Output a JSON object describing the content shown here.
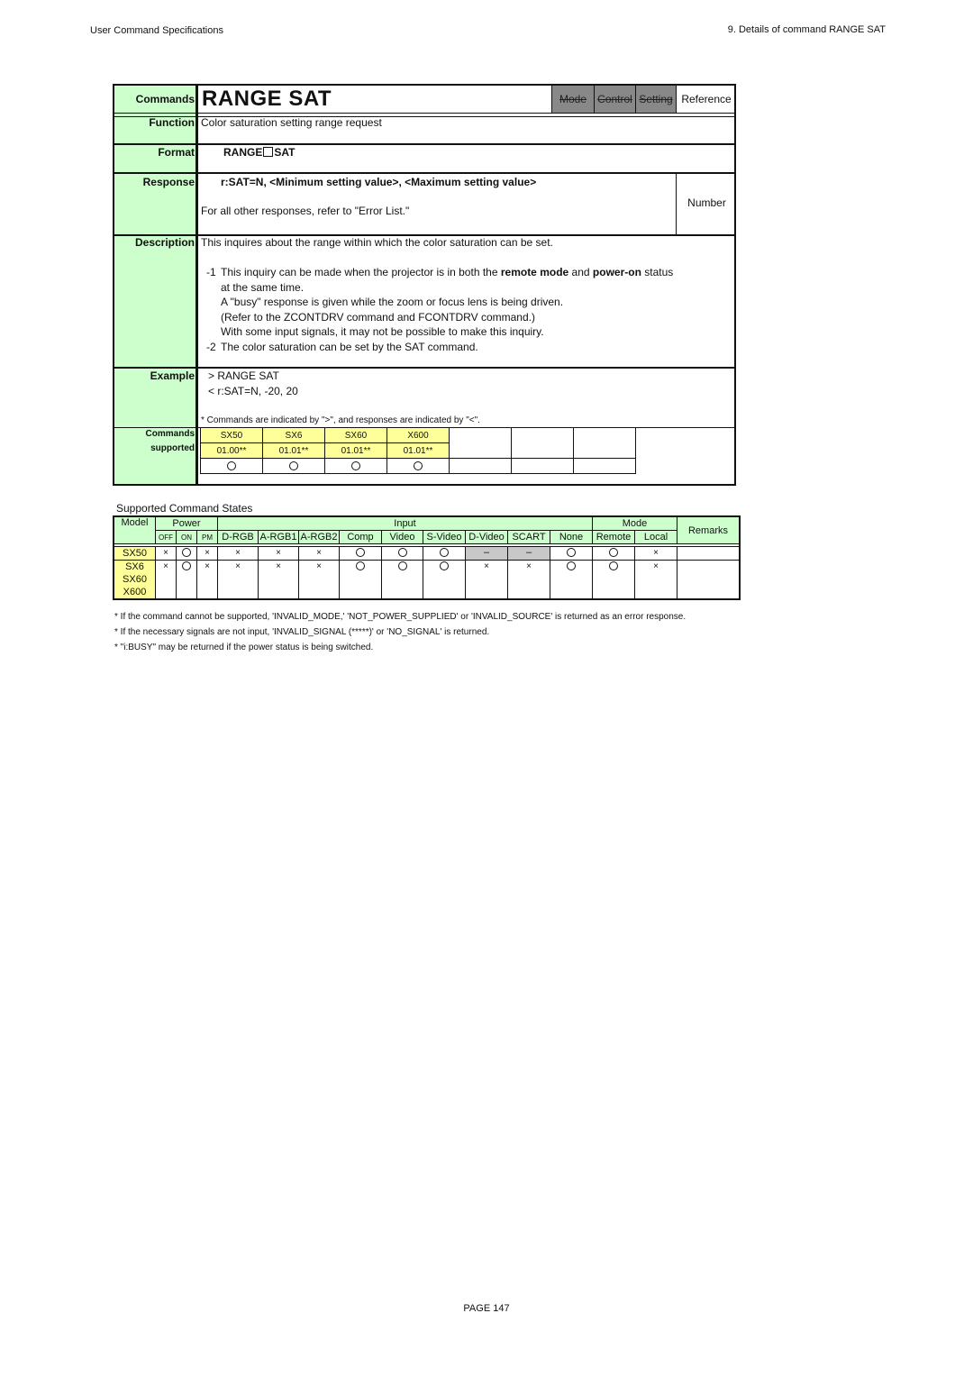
{
  "header": {
    "left": "User Command Specifications",
    "right": "9. Details of command  RANGE SAT"
  },
  "spec": {
    "commands_label": "Commands",
    "title": "RANGE SAT",
    "tabs": [
      {
        "label": "Mode",
        "active": false
      },
      {
        "label": "Control",
        "active": false
      },
      {
        "label": "Setting",
        "active": false
      },
      {
        "label": "Reference",
        "active": true
      }
    ],
    "function_label": "Function",
    "function_text": "Color saturation setting range request",
    "format_label": "Format",
    "format_pre": "RANGE",
    "format_post": "SAT",
    "response_label": "Response",
    "response_text": "r:SAT=N, <Minimum setting value>, <Maximum setting value>",
    "response_other": "For all other responses, refer to \"Error List.\"",
    "response_type": "Number",
    "description_label": "Description",
    "description_intro": "This inquires about the range within which the color saturation can be set.",
    "note1_num": "-1",
    "note1_a": "This inquiry can be made when the projector is in both the ",
    "note1_b": "remote mode",
    "note1_c": " and ",
    "note1_d": "power-on",
    "note1_e": " status",
    "note1_lines": [
      "at the same time.",
      "A \"busy\" response is given while the zoom or focus lens is being driven.",
      "(Refer to the ZCONTDRV command and FCONTDRV command.)",
      "With some input signals, it may not be possible to make this inquiry."
    ],
    "note2_num": "-2",
    "note2_text": "The color saturation can be set by the SAT command.",
    "example_label": "Example",
    "example_cmd": ">  RANGE SAT",
    "example_resp": "<  r:SAT=N, -20, 20",
    "example_note": "* Commands are indicated by \">\", and responses are indicated by \"<\".",
    "supported_label_1": "Commands",
    "supported_label_2": "supported",
    "supported_models": [
      {
        "model": "SX50",
        "version": "01.00**",
        "supported": true
      },
      {
        "model": "SX6",
        "version": "01.01**",
        "supported": true
      },
      {
        "model": "SX60",
        "version": "01.01**",
        "supported": true
      },
      {
        "model": "X600",
        "version": "01.01**",
        "supported": true
      }
    ]
  },
  "states": {
    "title": "Supported Command States",
    "headers": {
      "model": "Model",
      "power": "Power",
      "input": "Input",
      "mode": "Mode",
      "remarks": "Remarks",
      "power_cols": [
        "OFF",
        "ON",
        "PM"
      ],
      "input_cols": [
        "D-RGB",
        "A-RGB1",
        "A-RGB2",
        "Comp",
        "Video",
        "S-Video",
        "D-Video",
        "SCART",
        "None"
      ],
      "mode_cols": [
        "Remote",
        "Local"
      ]
    },
    "rows": [
      {
        "models": [
          "SX50"
        ],
        "values": [
          "x",
          "o",
          "x",
          "x",
          "x",
          "x",
          "o",
          "o",
          "o",
          "-",
          "-",
          "o",
          "o",
          "x"
        ],
        "remarks": ""
      },
      {
        "models": [
          "SX6",
          "SX60",
          "X600"
        ],
        "values": [
          "x",
          "o",
          "x",
          "x",
          "x",
          "x",
          "o",
          "o",
          "o",
          "x",
          "x",
          "o",
          "o",
          "x"
        ],
        "remarks": ""
      }
    ],
    "notes": [
      "* If the command cannot be supported, 'INVALID_MODE,' 'NOT_POWER_SUPPLIED' or 'INVALID_SOURCE' is returned as an error response.",
      "* If the necessary signals are not input, 'INVALID_SIGNAL (*****)' or 'NO_SIGNAL' is returned.",
      "* \"i:BUSY\" may be returned if the power status is being switched."
    ]
  },
  "footer": {
    "page": "PAGE 147"
  }
}
